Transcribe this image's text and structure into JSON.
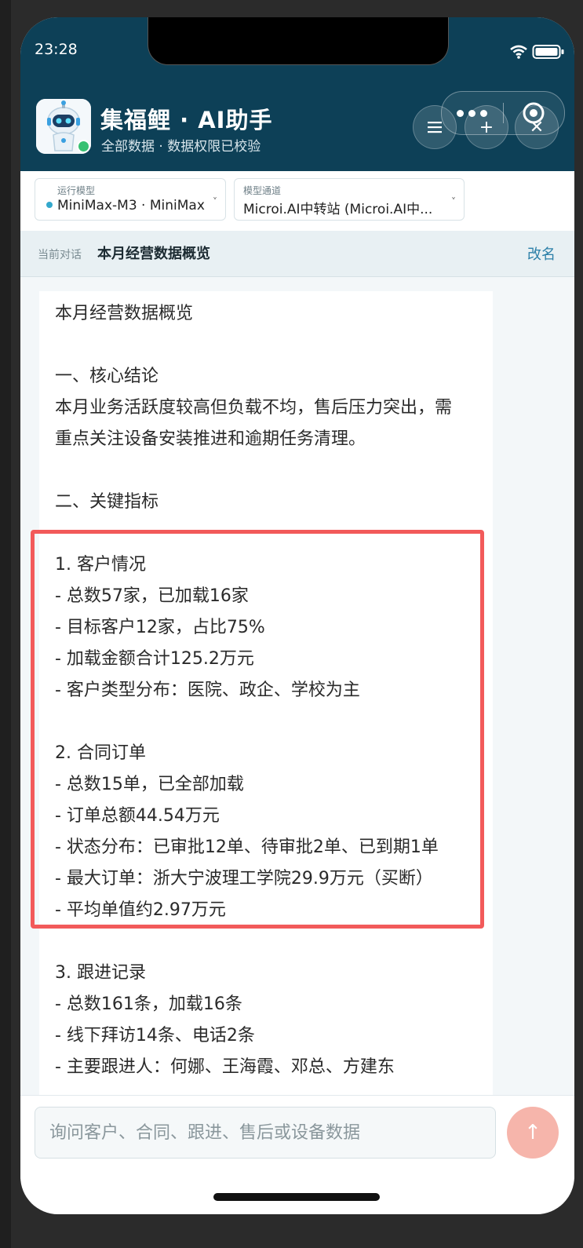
{
  "status_bar": {
    "time": "23:28"
  },
  "header": {
    "title": "集福鲤 · AI助手",
    "subtitle": "全部数据 · 数据权限已校验",
    "menu_icon": "menu-icon",
    "add_icon": "plus-icon",
    "close_icon": "close-icon"
  },
  "selectors": {
    "model": {
      "label": "运行模型",
      "value": "MiniMax-M3 · MiniMax"
    },
    "channel": {
      "label": "模型通道",
      "value": "Microi.AI中转站 (Microi.AI中..."
    }
  },
  "conversation": {
    "label": "当前对话",
    "title": "本月经营数据概览",
    "rename": "改名"
  },
  "message": {
    "lines": [
      "本月经营数据概览",
      "",
      "一、核心结论",
      "本月业务活跃度较高但负载不均，售后压力突出，需",
      "重点关注设备安装推进和逾期任务清理。",
      "",
      "二、关键指标",
      "",
      "1. 客户情况",
      "- 总数57家，已加载16家",
      "- 目标客户12家，占比75%",
      "- 加载金额合计125.2万元",
      "- 客户类型分布：医院、政企、学校为主",
      "",
      "2. 合同订单",
      "- 总数15单，已全部加载",
      "- 订单总额44.54万元",
      "- 状态分布：已审批12单、待审批2单、已到期1单",
      "- 最大订单：浙大宁波理工学院29.9万元（买断）",
      "- 平均单值约2.97万元",
      "",
      "3. 跟进记录",
      "- 总数161条，加载16条",
      "- 线下拜访14条、电话2条",
      "- 主要跟进人：何娜、王海霞、邓总、方建东"
    ]
  },
  "input": {
    "placeholder": "询问客户、合同、跟进、售后或设备数据"
  },
  "colors": {
    "header_bg": "#0d4057",
    "highlight": "#f25a5a",
    "send_button": "#f6b5ab",
    "accent": "#2b7fa8"
  }
}
